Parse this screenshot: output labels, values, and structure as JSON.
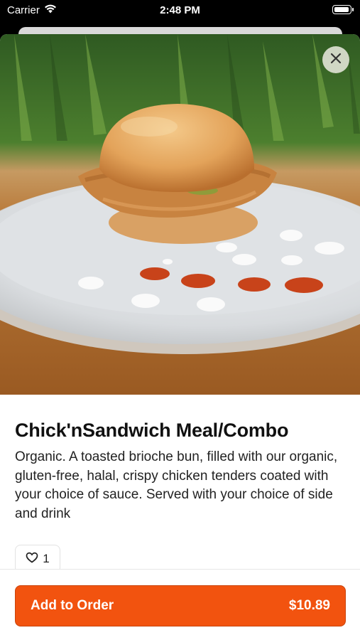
{
  "status_bar": {
    "carrier": "Carrier",
    "time": "2:48 PM"
  },
  "item": {
    "title": "Chick'nSandwich Meal/Combo",
    "description": "Organic. A toasted brioche bun, filled with our organic, gluten-free, halal, crispy chicken tenders coated with your choice of sauce. Served with your choice of side and drink",
    "like_count": "1"
  },
  "actions": {
    "add_label": "Add to Order",
    "price": "$10.89",
    "accent_color": "#f2530f"
  },
  "icons": {
    "close": "close-icon",
    "like": "heart-icon",
    "wifi": "wifi-icon",
    "battery": "battery-icon"
  }
}
